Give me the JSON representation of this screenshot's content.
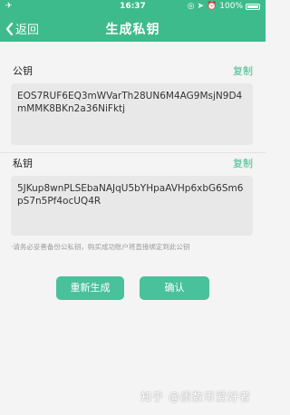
{
  "status_bar": {
    "time": "16:37",
    "battery_percent": "100%",
    "left_icon": "airplane-icon"
  },
  "nav": {
    "back_label": "返回",
    "title": "生成私钥"
  },
  "public_key": {
    "label": "公钥",
    "copy_label": "复制",
    "value": "EOS7RUF6EQ3mWVarTh28UN6M4AG9MsjN9D4mMMK8BKn2a36NiFktj"
  },
  "private_key": {
    "label": "私钥",
    "copy_label": "复制",
    "value": "5JKup8wnPLSEbaNAJqU5bYHpaAVHp6xbG6Sm6pS7n5Pf4ocUQ4R"
  },
  "warning": "·请务必妥善备份公私钥，购买成功账户将直接绑定到此公钥",
  "buttons": {
    "regenerate": "重新生成",
    "confirm": "确认"
  },
  "watermark": "知乎 @质数币爱好者",
  "colors": {
    "brand_green": "#3dbb8c",
    "button_green": "#49c19a",
    "key_box_bg": "#e8e8e8"
  }
}
